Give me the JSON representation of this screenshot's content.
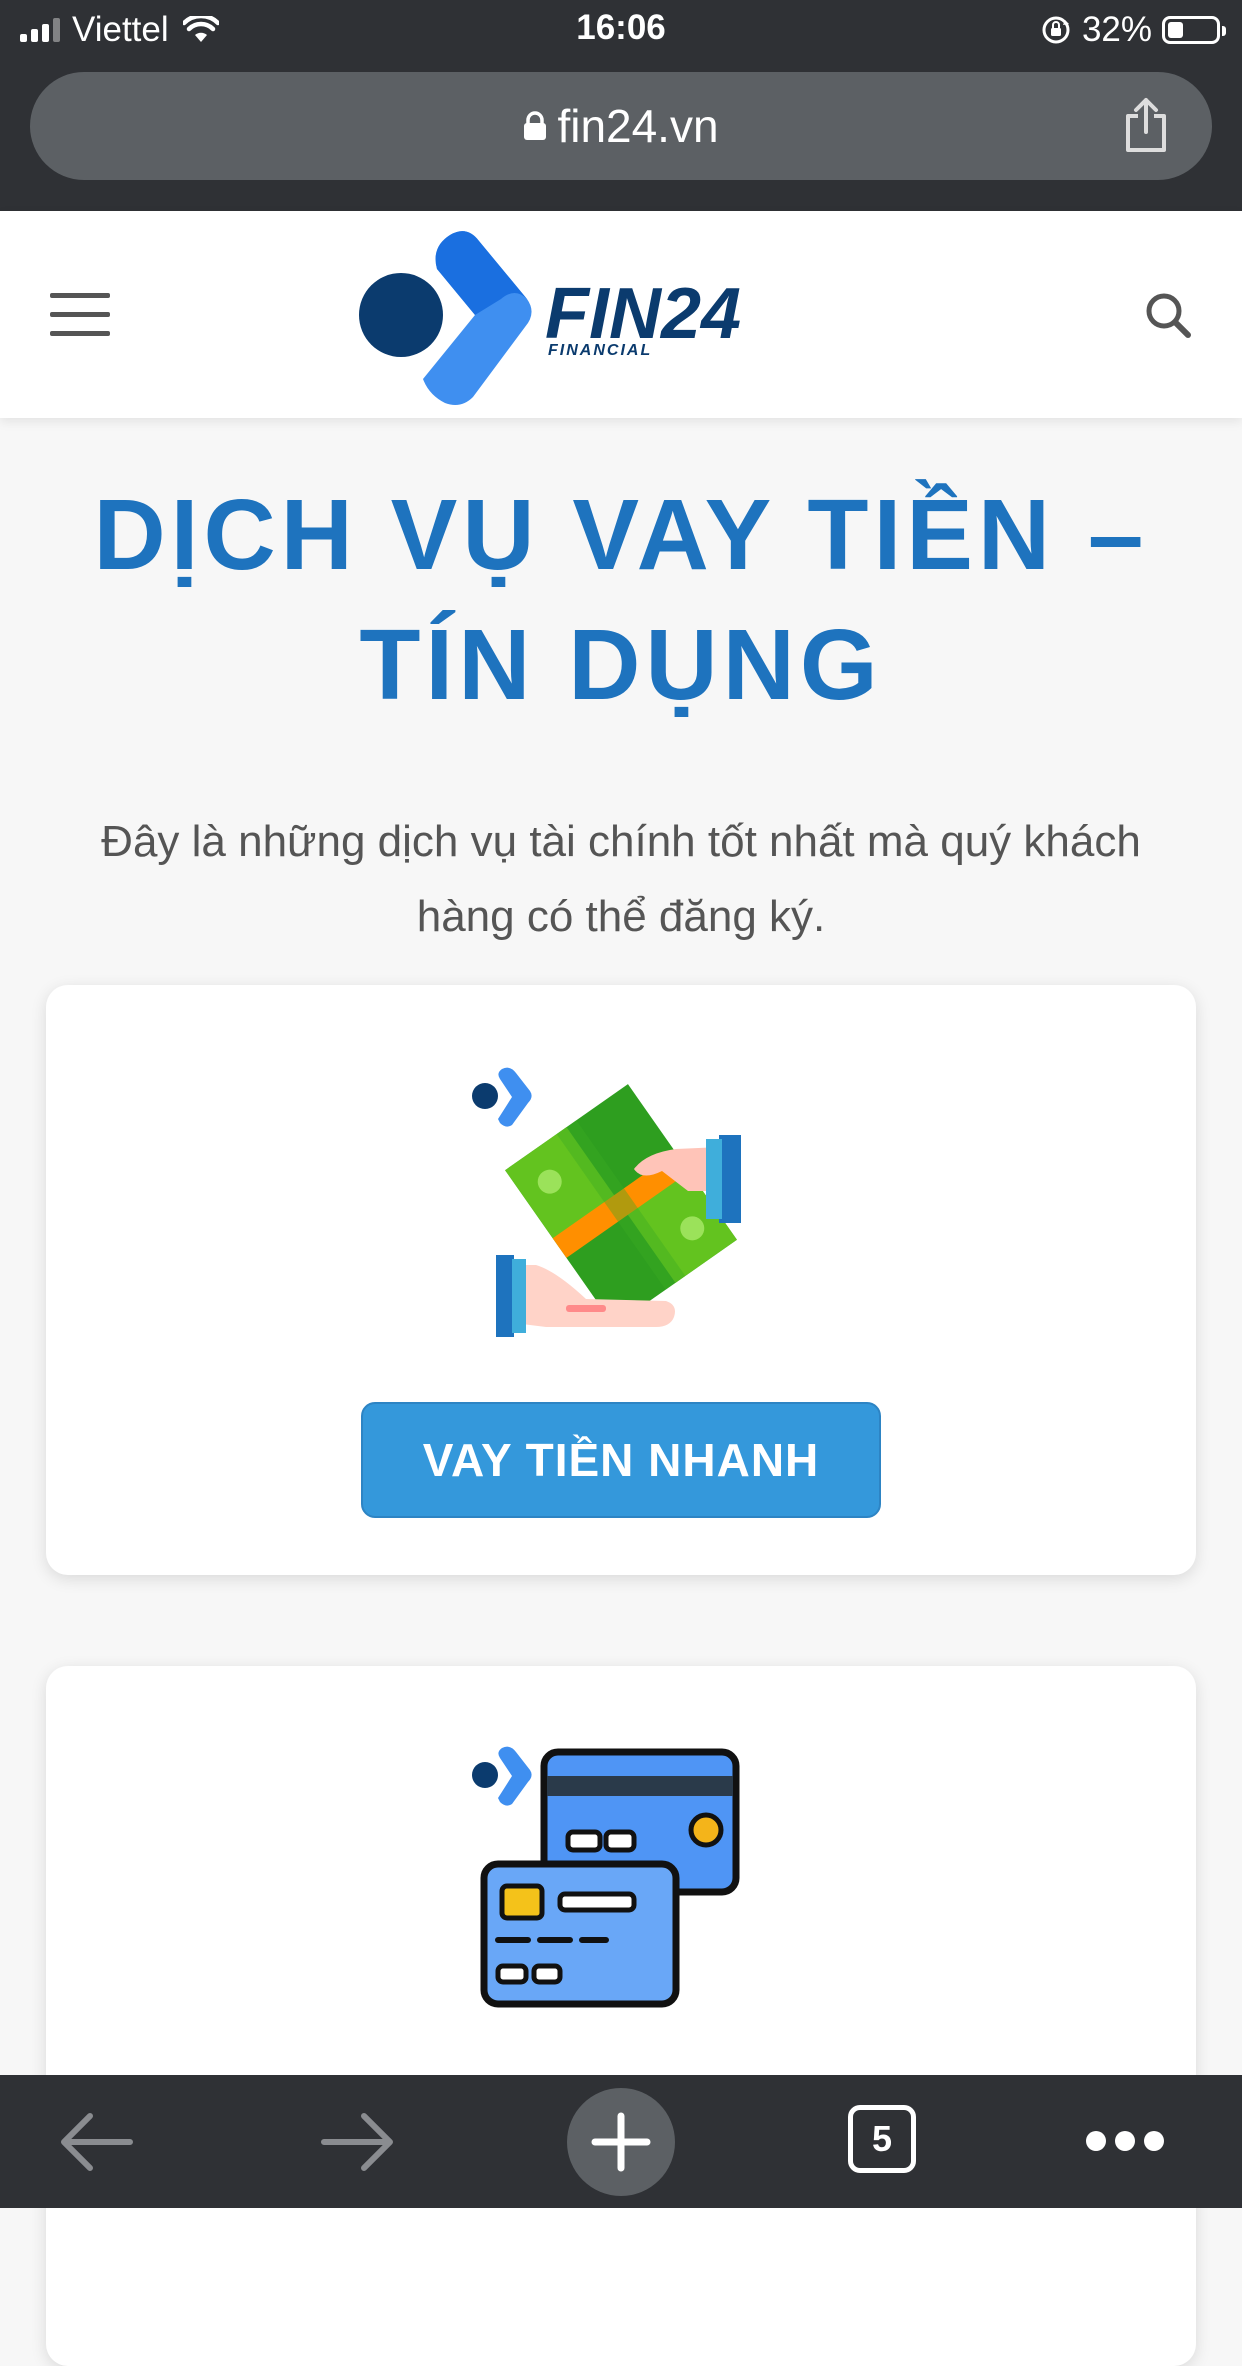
{
  "status_bar": {
    "carrier": "Viettel",
    "time": "16:06",
    "battery_percent": "32%",
    "battery_level": 0.32
  },
  "browser": {
    "url": "fin24.vn",
    "tab_count": "5"
  },
  "site": {
    "logo_text": "FIN24",
    "logo_subtext": "FINANCIAL"
  },
  "main": {
    "title_line1": "DỊCH VỤ VAY TIỀN –",
    "title_line2": "TÍN DỤNG",
    "subtitle": "Đây là những dịch vụ tài chính tốt nhất mà quý khách hàng có thể đăng ký.",
    "cards": [
      {
        "icon": "cash-hands-icon",
        "button_label": "VAY TIỀN NHANH"
      },
      {
        "icon": "credit-cards-icon"
      }
    ]
  },
  "colors": {
    "title": "#1e73be",
    "button": "#3498db",
    "chrome": "#2f3135"
  }
}
